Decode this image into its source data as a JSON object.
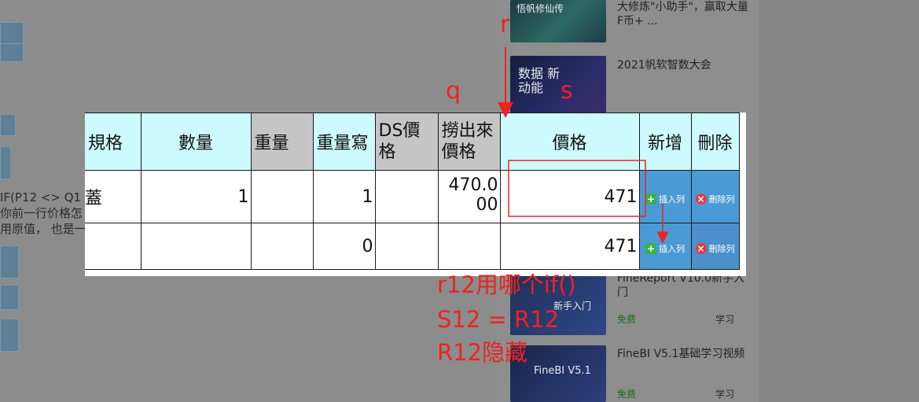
{
  "background": {
    "left_texts": [
      "IF(P12 <> Q1",
      "你前一行价格怎",
      "用原值， 也是一"
    ],
    "sidebar": [
      {
        "title": "大修炼\"小助手\"，赢取大量F币+ ...",
        "thumb_text": "悟帆修仙传"
      },
      {
        "title": "2021帆软智数大会",
        "thumb_text": "数据 新动能"
      },
      {
        "title": "FineReport V10.0新手入门",
        "thumb_text": "新手入门",
        "free": "免费",
        "learn": "学习"
      },
      {
        "title": "FineBI V5.1基础学习视频",
        "thumb_text": "FineBI V5.1",
        "free": "免费",
        "learn": "学习"
      }
    ]
  },
  "table": {
    "headers": [
      "規格",
      "數量",
      "重量",
      "重量寫",
      "DS價格",
      "撈出來價格",
      "價格",
      "新增",
      "刪除"
    ],
    "header_lines": {
      "ds": [
        "DS價",
        "格"
      ],
      "fetch": [
        "撈出來",
        "價格"
      ],
      "weight_write": "重量寫"
    },
    "rows": [
      {
        "spec": "蓋",
        "qty": "1",
        "weight": "",
        "weight_write": "1",
        "ds_price": "",
        "fetched_price": [
          "470.0",
          "00"
        ],
        "price": "471"
      },
      {
        "spec": "",
        "qty": "",
        "weight": "",
        "weight_write": "0",
        "ds_price": "",
        "fetched_price": [
          "",
          ""
        ],
        "price": "471"
      }
    ],
    "insert_label": "插入列",
    "delete_label": "刪除列"
  },
  "annotations": {
    "r": "r",
    "q": "q",
    "s": "s",
    "notes": [
      "r12用哪个if()",
      "S12 = R12",
      "R12隐藏"
    ]
  },
  "colors": {
    "accent_red": "#ee2222",
    "header_cyan": "#ccfaff",
    "header_gray": "#c5c5c5",
    "button_blue": "#4a9ad6"
  }
}
